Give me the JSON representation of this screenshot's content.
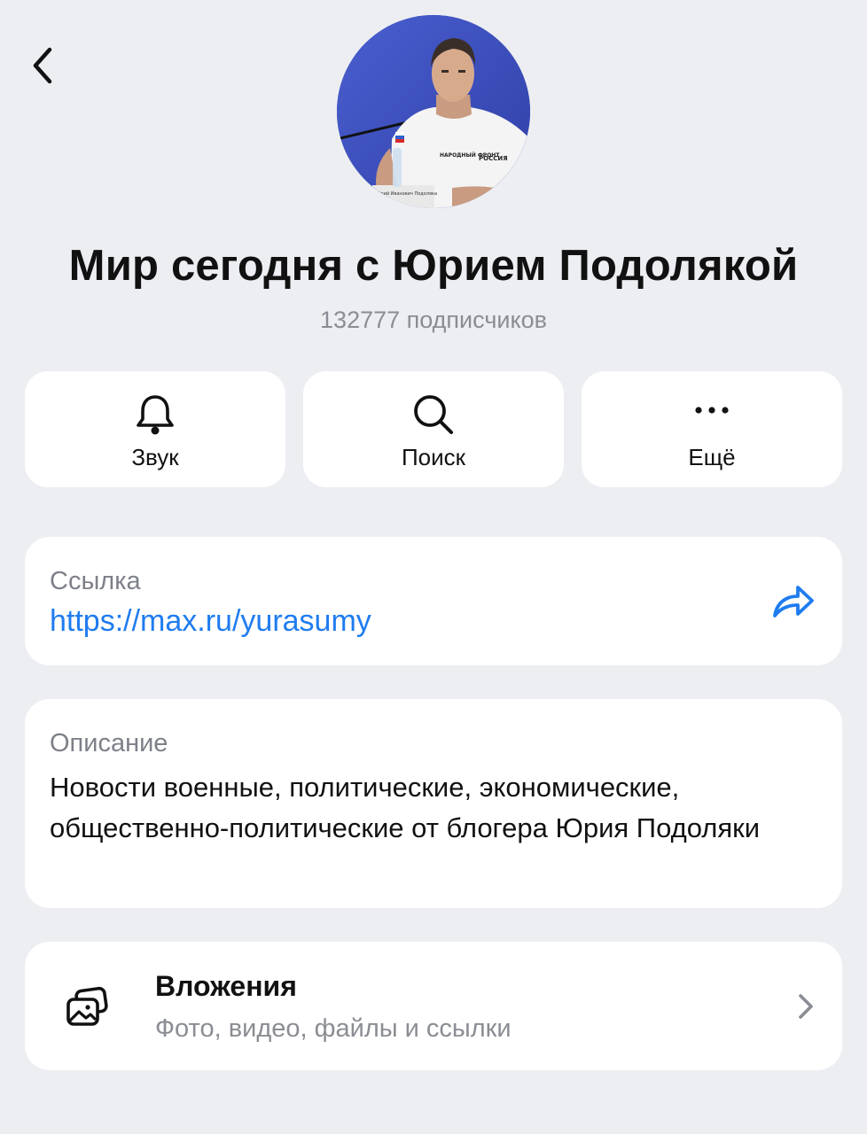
{
  "header": {
    "back_icon": "chevron-left-icon"
  },
  "channel": {
    "title": "Мир сегодня с Юрием Подолякой",
    "subscribers": "132777 подписчиков",
    "avatar_badge_text": "Юрий Иванович Подоляка",
    "avatar_shirt_text_1": "НАРОДНЫЙ ФРОНТ",
    "avatar_shirt_text_2": "РОССИЯ"
  },
  "actions": [
    {
      "label": "Звук",
      "icon": "bell-icon"
    },
    {
      "label": "Поиск",
      "icon": "search-icon"
    },
    {
      "label": "Ещё",
      "icon": "more-dots-icon"
    }
  ],
  "link_card": {
    "label": "Ссылка",
    "url": "https://max.ru/yurasumy",
    "share_icon": "share-arrow-icon"
  },
  "description_card": {
    "label": "Описание",
    "text": "Новости военные, политические, экономические, общественно-политические от блогера Юрия Подоляки"
  },
  "attachments_card": {
    "title": "Вложения",
    "subtitle": "Фото, видео, файлы и ссылки",
    "icon": "gallery-icon",
    "chevron_icon": "chevron-right-icon"
  },
  "colors": {
    "background": "#eceef2",
    "card": "#ffffff",
    "accent": "#1f7cf0",
    "secondary_text": "#8a8d93"
  }
}
